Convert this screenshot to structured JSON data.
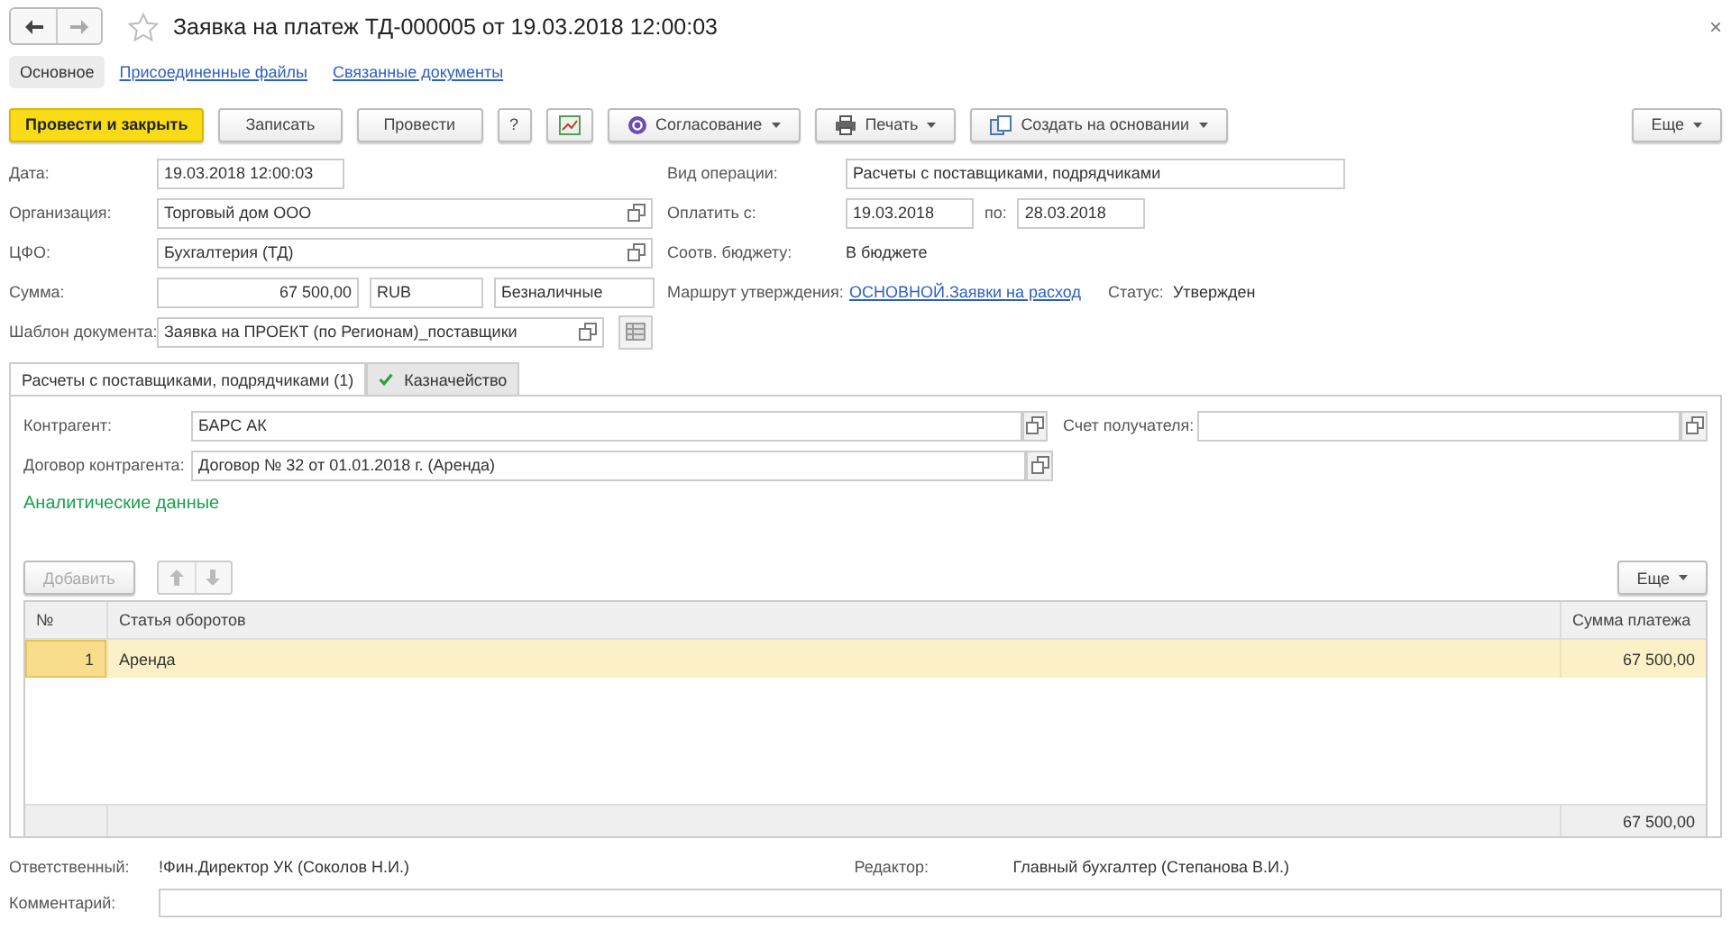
{
  "window": {
    "title": "Заявка на платеж ТД-000005 от 19.03.2018 12:00:03",
    "close": "×"
  },
  "nav_tabs": [
    {
      "label": "Основное",
      "selected": true
    },
    {
      "label": "Присоединенные файлы",
      "selected": false
    },
    {
      "label": "Связанные документы",
      "selected": false
    }
  ],
  "toolbar": [
    {
      "kind": "primary",
      "label": "Провести и закрыть"
    },
    {
      "kind": "button",
      "label": "Записать"
    },
    {
      "kind": "button",
      "label": "Провести"
    },
    {
      "kind": "button",
      "label": "?"
    },
    {
      "kind": "report"
    },
    {
      "kind": "approval",
      "label": "Согласование"
    },
    {
      "kind": "print",
      "label": "Печать"
    },
    {
      "kind": "create",
      "label": "Создать на основании"
    },
    {
      "kind": "more",
      "label": "Еще"
    }
  ],
  "form_left": [
    {
      "kind": "date",
      "label": "Дата:",
      "value": "19.03.2018 12:00:03"
    },
    {
      "kind": "ref",
      "label": "Организация:",
      "value": "Торговый дом ООО"
    },
    {
      "kind": "ref",
      "label": "ЦФО:",
      "value": "Бухгалтерия (ТД)"
    },
    {
      "kind": "amount",
      "label": "Сумма:",
      "values": [
        "67 500,00",
        "RUB",
        "Безналичные"
      ]
    },
    {
      "kind": "template",
      "label": "Шаблон документа:",
      "value": "Заявка на ПРОЕКТ (по Регионам)_поставщики"
    }
  ],
  "form_right": [
    {
      "kind": "field",
      "label": "Вид операции:",
      "value": "Расчеты с поставщиками, подрядчиками"
    },
    {
      "kind": "period",
      "label": "Оплатить с:",
      "value": "19.03.2018",
      "to_label": "по:",
      "to_value": "28.03.2018"
    },
    {
      "kind": "text",
      "label": "Соотв. бюджету:",
      "value": "В бюджете"
    },
    {
      "kind": "link",
      "label": "Маршрут утверждения:",
      "value": "ОСНОВНОЙ.Заявки на расход",
      "status_label": "Статус:",
      "status_value": "Утвержден"
    }
  ],
  "detail_tabs": [
    {
      "label": "Расчеты с поставщиками, подрядчиками (1)",
      "selected": true,
      "checked": false
    },
    {
      "label": "Казначейство",
      "selected": false,
      "checked": true
    }
  ],
  "panel": {
    "counterparty": {
      "label": "Контрагент:",
      "value": "БАРС АК"
    },
    "account": {
      "label": "Счет получателя:"
    },
    "contract": {
      "label": "Договор контрагента:",
      "value": "Договор № 32 от 01.01.2018 г. (Аренда)"
    },
    "section_title": "Аналитические данные",
    "table_toolbar": {
      "add": {
        "label": "Добавить",
        "disabled": true
      },
      "more": "Еще"
    },
    "table": {
      "columns": [
        "№",
        "Статья оборотов",
        "Сумма платежа"
      ],
      "rows": [
        {
          "cells": [
            "1",
            "Аренда",
            "67 500,00"
          ],
          "selected": true
        }
      ],
      "total": "67 500,00"
    }
  },
  "footer": {
    "responsible_label": "Ответственный:",
    "responsible": "!Фин.Директор УК (Соколов Н.И.)",
    "editor_label": "Редактор:",
    "editor": "Главный бухгалтер (Степанова В.И.)",
    "comment_label": "Комментарий:"
  }
}
